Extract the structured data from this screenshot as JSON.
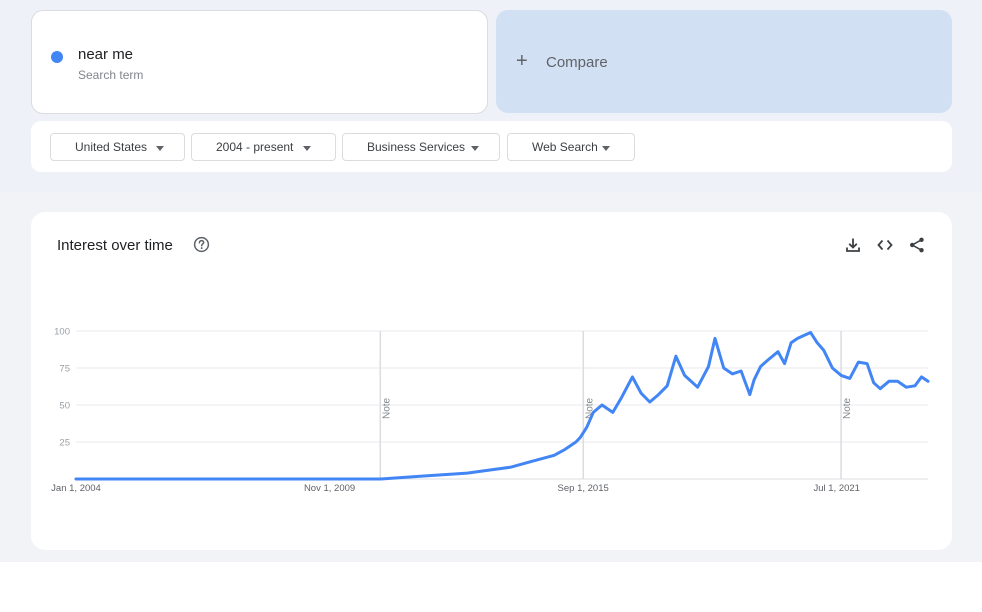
{
  "search_term": {
    "name": "near me",
    "subtitle": "Search term",
    "color": "#4285f4"
  },
  "compare": {
    "label": "Compare",
    "icon": "plus-icon"
  },
  "filters": {
    "region": "United States",
    "time_range": "2004 - present",
    "category": "Business Services",
    "search_type": "Web Search"
  },
  "chart_card": {
    "title": "Interest over time",
    "icons": [
      "help-icon",
      "download-icon",
      "embed-icon",
      "share-icon"
    ]
  },
  "chart_data": {
    "type": "line",
    "title": "Interest over time",
    "xlabel": "",
    "ylabel": "",
    "ylim": [
      0,
      100
    ],
    "yticks": [
      25,
      50,
      75,
      100
    ],
    "x_tick_labels": [
      "Jan 1, 2004",
      "Nov 1, 2009",
      "Sep 1, 2015",
      "Jul 1, 2021"
    ],
    "x_tick_years": [
      2004.0,
      2009.833,
      2015.667,
      2021.5
    ],
    "x_range": [
      2004.0,
      2023.6
    ],
    "notes": [
      {
        "year": 2011.0,
        "label": "Note"
      },
      {
        "year": 2015.67,
        "label": "Note"
      },
      {
        "year": 2021.6,
        "label": "Note"
      }
    ],
    "grid": true,
    "color": "#4285f4",
    "series": [
      {
        "x": [
          2004.0,
          2011.0,
          2012.0,
          2013.0,
          2013.5,
          2014.0,
          2014.5,
          2015.0,
          2015.25,
          2015.5,
          2015.6,
          2015.75,
          2015.9,
          2016.1,
          2016.35,
          2016.55,
          2016.8,
          2017.0,
          2017.2,
          2017.4,
          2017.6,
          2017.8,
          2018.0,
          2018.3,
          2018.55,
          2018.7,
          2018.9,
          2019.1,
          2019.3,
          2019.5,
          2019.6,
          2019.75,
          2019.9,
          2020.15,
          2020.3,
          2020.45,
          2020.6,
          2020.75,
          2020.9,
          2021.05,
          2021.2,
          2021.4,
          2021.6,
          2021.8,
          2022.0,
          2022.2,
          2022.35,
          2022.5,
          2022.7,
          2022.9,
          2023.1,
          2023.3,
          2023.45,
          2023.6
        ],
        "y": [
          0,
          0,
          2,
          4,
          6,
          8,
          12,
          16,
          20,
          25,
          28,
          35,
          45,
          50,
          45,
          55,
          69,
          58,
          52,
          57,
          63,
          83,
          70,
          62,
          76,
          95,
          75,
          71,
          73,
          57,
          67,
          76,
          80,
          86,
          78,
          92,
          95,
          97,
          99,
          92,
          87,
          75,
          70,
          68,
          79,
          78,
          65,
          61,
          66,
          66,
          62,
          63,
          69,
          66
        ]
      }
    ]
  }
}
